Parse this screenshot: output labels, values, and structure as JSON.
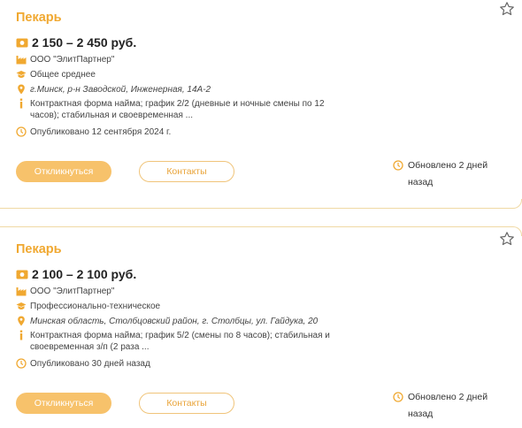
{
  "colors": {
    "accent": "#f0a830",
    "button": "#f7c26b",
    "border": "#f0d9a4"
  },
  "vacancies": [
    {
      "title": "Пекарь",
      "salary": "2 150 – 2 450 руб.",
      "company": "ООО \"ЭлитПартнер\"",
      "education": "Общее среднее",
      "address": "г.Минск, р-н Заводской, Инженерная, 14А-2",
      "conditions": "Контрактная форма найма; график 2/2 (дневные и ночные смены по 12 часов); стабильная и своевременная ...",
      "published": "Опубликовано 12 сентября 2024 г.",
      "apply_label": "Откликнуться",
      "contacts_label": "Контакты",
      "updated": "Обновлено 2 дней назад"
    },
    {
      "title": "Пекарь",
      "salary": "2 100 – 2 100 руб.",
      "company": "ООО \"ЭлитПартнер\"",
      "education": "Профессионально-техническое",
      "address": "Минская область, Столбцовский район, г. Столбцы, ул. Гайдука, 20",
      "conditions": "Контрактная форма найма; график 5/2 (смены по 8 часов); стабильная и своевременная з/п (2 раза ...",
      "published": "Опубликовано 30 дней назад",
      "apply_label": "Откликнуться",
      "contacts_label": "Контакты",
      "updated": "Обновлено 2 дней назад"
    }
  ]
}
